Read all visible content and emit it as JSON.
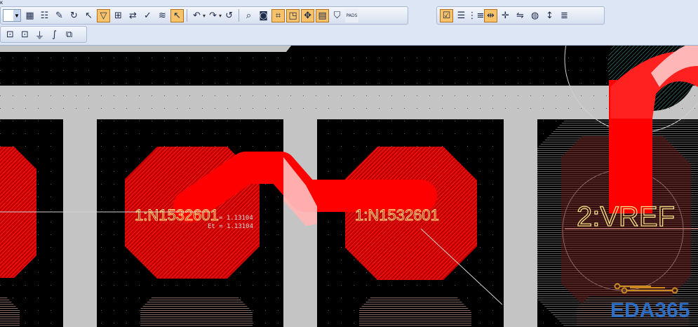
{
  "toolbar": {
    "corner_label": "ĸ",
    "row1_left": [
      {
        "name": "properties-icon",
        "glyph": "▦"
      },
      {
        "name": "list-icon",
        "glyph": "☷"
      },
      {
        "name": "pin-icon",
        "glyph": "✎"
      },
      {
        "name": "refresh-icon",
        "glyph": "↻"
      },
      {
        "name": "select-arrow-icon",
        "glyph": "↖"
      },
      {
        "name": "drc-filter-icon",
        "glyph": "▽",
        "active": true
      },
      {
        "name": "ruler-icon",
        "glyph": "⊞"
      },
      {
        "name": "component-swap-icon",
        "glyph": "⇄"
      },
      {
        "name": "check-doc-icon",
        "glyph": "✓"
      },
      {
        "name": "net-highlight-icon",
        "glyph": "≋"
      },
      {
        "name": "select-mode-icon",
        "glyph": "↖",
        "active": true
      }
    ],
    "row1_undo": [
      {
        "name": "undo-icon",
        "glyph": "↶"
      },
      {
        "name": "redo-icon",
        "glyph": "↷"
      },
      {
        "name": "repeat-icon",
        "glyph": "↺"
      }
    ],
    "row1_view": [
      {
        "name": "zoom-icon",
        "glyph": "⌕"
      },
      {
        "name": "view-3d-icon",
        "glyph": "◙"
      },
      {
        "name": "route-icon",
        "glyph": "⌗",
        "active": true
      },
      {
        "name": "window-icon",
        "glyph": "◳",
        "active": true
      },
      {
        "name": "move-icon",
        "glyph": "✥",
        "active": true
      },
      {
        "name": "table-icon",
        "glyph": "▤",
        "active": true
      },
      {
        "name": "filter-icon",
        "glyph": "⛉"
      },
      {
        "name": "pads-icon",
        "glyph": "PADS"
      }
    ],
    "row1_right": [
      {
        "name": "drc-check-icon",
        "glyph": "☑",
        "active": true
      },
      {
        "name": "checklist-icon",
        "glyph": "☰"
      },
      {
        "name": "hierarchy-icon",
        "glyph": "⋮≡"
      },
      {
        "name": "align-icon",
        "glyph": "⇹",
        "active": true
      },
      {
        "name": "spread-icon",
        "glyph": "✛"
      },
      {
        "name": "swap-pins-icon",
        "glyph": "⇋"
      },
      {
        "name": "via-icon",
        "glyph": "◍"
      },
      {
        "name": "measure-icon",
        "glyph": "↕"
      },
      {
        "name": "report-icon",
        "glyph": "≣"
      }
    ],
    "row2": [
      {
        "name": "lock-icon",
        "glyph": "⊡"
      },
      {
        "name": "lock-all-icon",
        "glyph": "⊡"
      },
      {
        "name": "ground-icon",
        "glyph": "⏚"
      },
      {
        "name": "arc-icon",
        "glyph": "∫"
      },
      {
        "name": "split-icon",
        "glyph": "⧉"
      }
    ]
  },
  "pcb": {
    "colors": {
      "background": "#000000",
      "plane": "#c4c4c4",
      "copper": "#e60000",
      "route": "#ff0000",
      "highlight": "#ffb8b8",
      "text": "#e8d96a"
    },
    "pad_labels": [
      "1:N1532601",
      "1:N1532601",
      "2:VREF"
    ],
    "measurement": {
      "line1": "= 1.13104",
      "line2": "Et = 1.13104"
    }
  },
  "watermark": {
    "text": "EDA365"
  }
}
